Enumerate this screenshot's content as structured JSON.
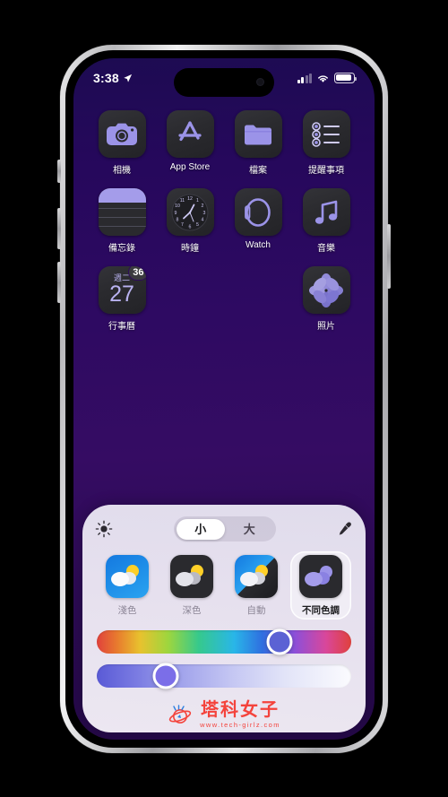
{
  "statusbar": {
    "time": "3:38",
    "location_icon": "location-arrow-icon",
    "signal_icon": "cellular-signal-icon",
    "wifi_icon": "wifi-icon",
    "battery_icon": "battery-icon"
  },
  "homescreen": {
    "rows": [
      [
        {
          "label": "相機",
          "icon": "camera-app-icon"
        },
        {
          "label": "App Store",
          "icon": "app-store-app-icon"
        },
        {
          "label": "檔案",
          "icon": "files-app-icon"
        },
        {
          "label": "提醒事項",
          "icon": "reminders-app-icon"
        }
      ],
      [
        {
          "label": "備忘錄",
          "icon": "notes-app-icon"
        },
        {
          "label": "時鐘",
          "icon": "clock-app-icon"
        },
        {
          "label": "Watch",
          "icon": "watch-app-icon"
        },
        {
          "label": "音樂",
          "icon": "music-app-icon"
        }
      ],
      [
        {
          "label": "行事曆",
          "icon": "calendar-app-icon",
          "weekday": "週二",
          "day": "27",
          "badge": "36"
        },
        {
          "label": "照片",
          "icon": "photos-app-icon"
        }
      ]
    ]
  },
  "panel": {
    "brightness_icon": "brightness-sun-icon",
    "eyedropper_icon": "eyedropper-icon",
    "size_segments": [
      {
        "label": "小",
        "selected": true
      },
      {
        "label": "大",
        "selected": false
      }
    ],
    "appearance_options": [
      {
        "label": "淺色",
        "icon": "light-appearance-icon",
        "selected": false
      },
      {
        "label": "深色",
        "icon": "dark-appearance-icon",
        "selected": false
      },
      {
        "label": "自動",
        "icon": "auto-appearance-icon",
        "selected": false
      },
      {
        "label": "不同色調",
        "icon": "tinted-appearance-icon",
        "selected": true
      }
    ],
    "sliders": [
      {
        "name": "hue-slider",
        "value_percent": 72,
        "thumb_color": "#5b62d4"
      },
      {
        "name": "tint-intensity-slider",
        "value_percent": 27,
        "thumb_color": "#7b6ee8"
      }
    ]
  },
  "watermark": {
    "brand": "塔科女子",
    "url": "www.tech-girlz.com",
    "logo_icon": "saturn-planet-logo-icon"
  },
  "colors": {
    "wallpaper_top": "#1d0b52",
    "wallpaper_mid": "#350c63",
    "icon_tint": "#a49cea",
    "panel_bg": "#e6e0ee",
    "watermark_red": "#f4433c"
  }
}
